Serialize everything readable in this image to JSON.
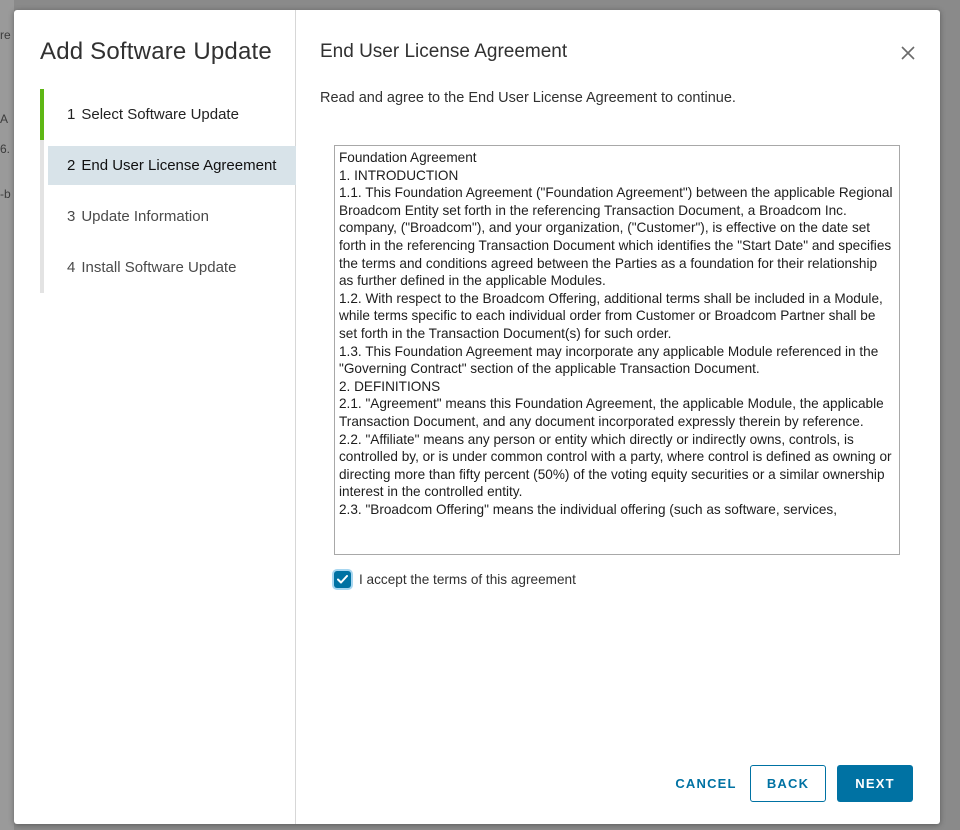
{
  "background": {
    "fragments": [
      "re",
      "A",
      "6.",
      "-b"
    ]
  },
  "wizard": {
    "title": "Add Software Update",
    "steps": [
      {
        "num": "1",
        "label": "Select Software Update",
        "state": "done"
      },
      {
        "num": "2",
        "label": "End User License Agreement",
        "state": "active"
      },
      {
        "num": "3",
        "label": "Update Information",
        "state": "pending"
      },
      {
        "num": "4",
        "label": "Install Software Update",
        "state": "pending"
      }
    ]
  },
  "content": {
    "title": "End User License Agreement",
    "instruction": "Read and agree to the End User License Agreement to continue.",
    "eula_paragraphs": [
      "Foundation Agreement",
      "1. INTRODUCTION",
      "1.1. This Foundation Agreement (\"Foundation Agreement\") between the applicable Regional Broadcom Entity set forth in the referencing Transaction Document, a Broadcom Inc. company, (\"Broadcom\"), and your organization, (\"Customer\"), is effective on the date set forth in the referencing Transaction Document which identifies the \"Start Date\" and specifies the terms and conditions agreed between the Parties as a foundation for their relationship as further defined in the applicable Modules.",
      "1.2. With respect to the Broadcom Offering, additional terms shall be included in a Module, while terms specific to each individual order from Customer or Broadcom Partner shall be set forth in the Transaction Document(s) for such order.",
      "1.3. This Foundation Agreement may incorporate any applicable Module referenced in the \"Governing Contract\" section of the applicable Transaction Document.",
      "2. DEFINITIONS",
      "2.1. \"Agreement\" means this Foundation Agreement, the applicable Module, the applicable Transaction Document, and any document incorporated expressly therein by reference.",
      "2.2. \"Affiliate\" means any person or entity which directly or indirectly owns, controls, is controlled by, or is under common control with a party, where control is defined as owning or directing more than fifty percent (50%) of the voting equity securities or a similar ownership interest in the controlled entity.",
      "2.3. \"Broadcom Offering\" means the individual offering (such as software, services,"
    ],
    "accept_label": "I accept the terms of this agreement",
    "accept_checked": true
  },
  "buttons": {
    "cancel": "CANCEL",
    "back": "BACK",
    "next": "NEXT"
  },
  "colors": {
    "accent": "#0072a3",
    "step_done": "#5eb715",
    "active_step_bg": "#d8e3e9"
  }
}
